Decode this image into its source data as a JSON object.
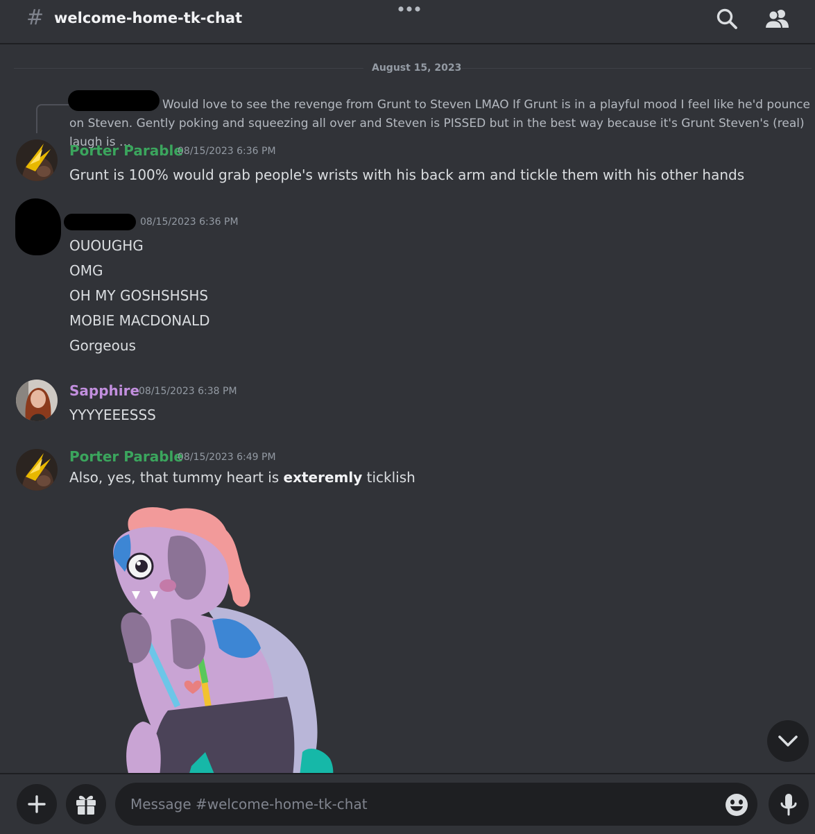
{
  "header": {
    "hash_icon": "#",
    "channel_name": "welcome-home-tk-chat",
    "icons": [
      "more-dots-icon",
      "search-icon",
      "members-icon"
    ]
  },
  "date_divider": "August 15, 2023",
  "reply_preview": {
    "text": "Would love to see the revenge from Grunt to Steven LMAO If Grunt is in a playful mood I feel like he'd pounce on Steven. Gently poking and squeezing all over and Steven is PISSED but in the best way because it's Grunt Steven's (real) laugh is …"
  },
  "messages": [
    {
      "author": "Porter Parable",
      "timestamp": "08/15/2023 6:36 PM",
      "lines": [
        "Grunt is 100% would grab people's wrists with his back arm and tickle them with his other hands"
      ]
    },
    {
      "author": "",
      "timestamp": "08/15/2023 6:36 PM",
      "lines": [
        "OUOUGHG",
        "OMG",
        "OH MY GOSHSHSHS",
        "MOBIE MACDONALD",
        "Gorgeous"
      ]
    },
    {
      "author": "Sapphire",
      "timestamp": "08/15/2023 6:38 PM",
      "lines": [
        "YYYYEEESSS"
      ]
    },
    {
      "author": "Porter Parable",
      "timestamp": "08/15/2023 6:49 PM",
      "text_before": "Also, yes, that tummy heart is ",
      "text_bold": "exteremly",
      "text_after": " ticklish"
    }
  ],
  "composer": {
    "placeholder": "Message #welcome-home-tk-chat",
    "icons": [
      "plus-icon",
      "gift-icon",
      "emoji-icon",
      "microphone-icon"
    ]
  },
  "colors": {
    "background": "#313338",
    "porter_name": "#3ba55d",
    "sapphire_name": "#c28fde"
  }
}
